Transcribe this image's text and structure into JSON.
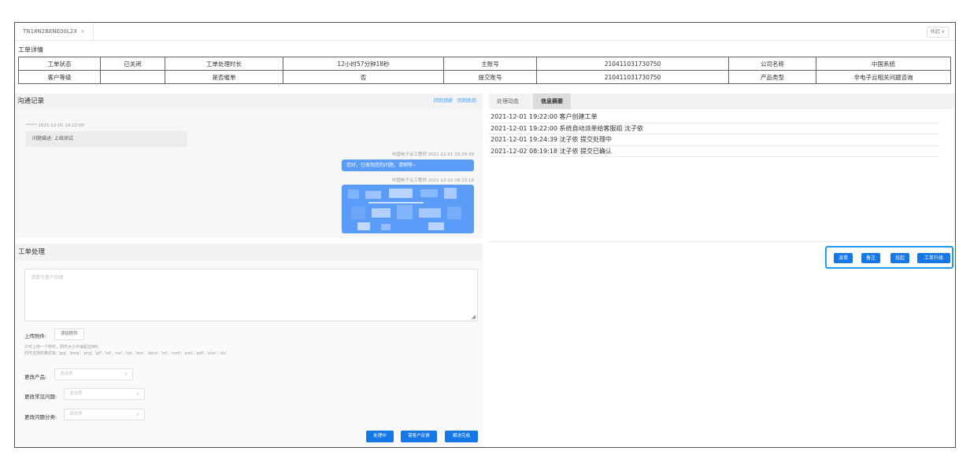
{
  "tabbar": {
    "tab_label": "TN18N2BENE00L2X",
    "tab_close": "×",
    "collapse_label": "收起 ∨"
  },
  "detail": {
    "title": "工单详情",
    "rows": [
      [
        "工单状态",
        "已关闭",
        "工单处理时长",
        "12小时57分钟18秒",
        "主账号",
        "210411031730750",
        "公司名称",
        "中国系统"
      ],
      [
        "客户等级",
        "",
        "是否催单",
        "否",
        "提交账号",
        "210411031730750",
        "产品类型",
        "非电子云相关问题咨询"
      ]
    ]
  },
  "comm": {
    "title": "沟通记录",
    "link_a": "回到顶部",
    "link_b": "回到底部",
    "left_meta": "***** 2021-12-01 19:22:00",
    "left_text": "问题描述: 上线测试",
    "right1_meta": "中国电子云工程师 2021-12-01 19:24:39",
    "right1_text": "您好，已收到您的问题，请稍等~",
    "right2_meta": "中国电子云工程师 2021-12-02 08:19:18"
  },
  "side": {
    "tabs": [
      "处理动态",
      "信息摘要"
    ],
    "events": [
      "2021-12-01 19:22:00 客户创建工单",
      "2021-12-01 19:22:00 系统自动派单给客服组 沈子依",
      "2021-12-01 19:24:39 沈子依 提交处理中",
      "2021-12-02 08:19:18 沈子依 提交已确认"
    ]
  },
  "actions": {
    "dispatch": "派单",
    "note": "备注",
    "reject": "挂起",
    "upgrade": "工单升级"
  },
  "handle": {
    "title": "工单处理",
    "reply_placeholder": "请填写客户回复",
    "upload_label": "上传附件:",
    "upload_btn": "添加附件",
    "hint1": "只可上传一个附件，附件大小不得超过8M;",
    "hint2": "附件支持的格式有: 'jpg', 'bmp', 'png', 'gif', 'txt', 'rar', 'zip', 'doc', 'docx', 'ini', 'conf', 'eml', 'pdf', 'xlsx', 'xls'",
    "product_label": "更改产品:",
    "issue_label": "更改常见问题:",
    "category_label": "更改问题分类:",
    "select_placeholder": "请选择",
    "btn_processing": "处理中",
    "btn_feedback": "需客户反馈",
    "btn_resolved": "解决完成"
  }
}
